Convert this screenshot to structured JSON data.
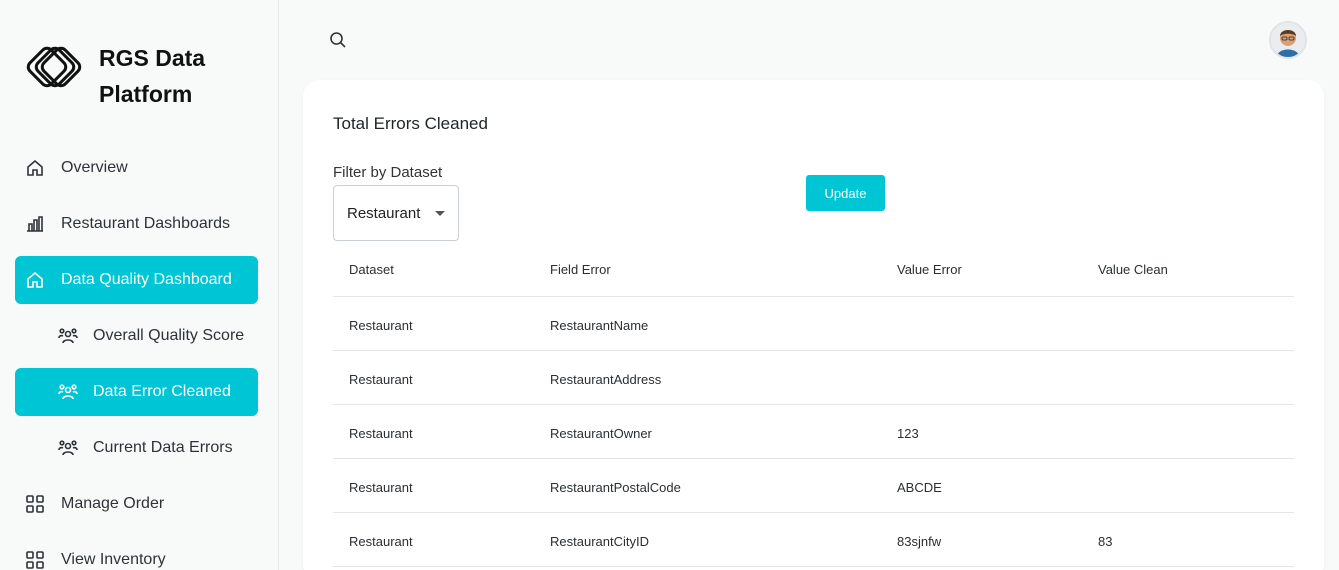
{
  "app": {
    "brand_name": "RGS Data Platform"
  },
  "sidebar": {
    "items": [
      {
        "label": "Overview",
        "icon": "home-icon"
      },
      {
        "label": "Restaurant Dashboards",
        "icon": "bar-chart-icon"
      },
      {
        "label": "Data Quality Dashboard",
        "icon": "home-icon"
      },
      {
        "label": "Overall Quality Score",
        "icon": "users-icon"
      },
      {
        "label": "Data Error Cleaned",
        "icon": "users-icon"
      },
      {
        "label": "Current Data Errors",
        "icon": "users-icon"
      },
      {
        "label": "Manage Order",
        "icon": "grid-icon"
      },
      {
        "label": "View Inventory",
        "icon": "grid-icon"
      }
    ]
  },
  "header": {
    "search_icon": "search-icon",
    "avatar_icon": "avatar"
  },
  "main": {
    "title": "Total Errors Cleaned",
    "filter_label": "Filter by Dataset",
    "filter_value": "Restaurant",
    "update_label": "Update",
    "table": {
      "columns": [
        "Dataset",
        "Field Error",
        "Value Error",
        "Value Clean"
      ],
      "rows": [
        [
          "Restaurant",
          "RestaurantName",
          "",
          ""
        ],
        [
          "Restaurant",
          "RestaurantAddress",
          "",
          ""
        ],
        [
          "Restaurant",
          "RestaurantOwner",
          "123",
          ""
        ],
        [
          "Restaurant",
          "RestaurantPostalCode",
          "ABCDE",
          ""
        ],
        [
          "Restaurant",
          "RestaurantCityID",
          "83sjnfw",
          "83"
        ]
      ]
    }
  },
  "colors": {
    "accent": "#00c5d4",
    "background": "#f8fafa",
    "card": "#ffffff"
  }
}
